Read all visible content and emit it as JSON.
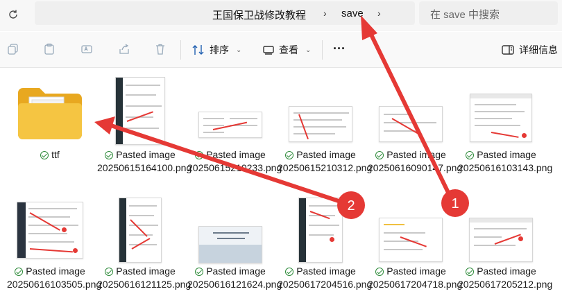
{
  "address": {
    "crumbs": [
      "王国保卫战修改教程",
      "save"
    ],
    "search_placeholder": "在 save 中搜索"
  },
  "toolbar": {
    "sort_label": "排序",
    "view_label": "查看",
    "more_label": "···",
    "details_label": "详细信息"
  },
  "icons": {
    "refresh": "refresh-icon",
    "copy": "copy-icon",
    "paste": "paste-icon",
    "rename": "rename-icon",
    "share": "share-icon",
    "delete": "delete-icon",
    "sort": "sort-icon",
    "view": "view-icon",
    "details": "details-pane-icon"
  },
  "files": [
    {
      "name_line1": "ttf",
      "name_line2": "",
      "type": "folder"
    },
    {
      "name_line1": "Pasted image",
      "name_line2": "20250615164100.png",
      "type": "image"
    },
    {
      "name_line1": "Pasted image",
      "name_line2": "20250615210233.png",
      "type": "image"
    },
    {
      "name_line1": "Pasted image",
      "name_line2": "20250615210312.png",
      "type": "image"
    },
    {
      "name_line1": "Pasted image",
      "name_line2": "20250616090147.png",
      "type": "image"
    },
    {
      "name_line1": "Pasted image",
      "name_line2": "20250616103143.png",
      "type": "image"
    },
    {
      "name_line1": "Pasted image",
      "name_line2": "20250616103505.png",
      "type": "image"
    },
    {
      "name_line1": "Pasted image",
      "name_line2": "20250616121125.png",
      "type": "image"
    },
    {
      "name_line1": "Pasted image",
      "name_line2": "20250616121624.png",
      "type": "image"
    },
    {
      "name_line1": "Pasted image",
      "name_line2": "20250617204516.png",
      "type": "image"
    },
    {
      "name_line1": "Pasted image",
      "name_line2": "20250617204718.png",
      "type": "image"
    },
    {
      "name_line1": "Pasted image",
      "name_line2": "20250617205212.png",
      "type": "image"
    }
  ],
  "annotations": [
    {
      "label": "1",
      "target": "save breadcrumb"
    },
    {
      "label": "2",
      "target": "ttf folder"
    }
  ],
  "colors": {
    "annotation": "#e53935",
    "folder": "#f5c542",
    "sync_ok": "#2e8b3a"
  }
}
